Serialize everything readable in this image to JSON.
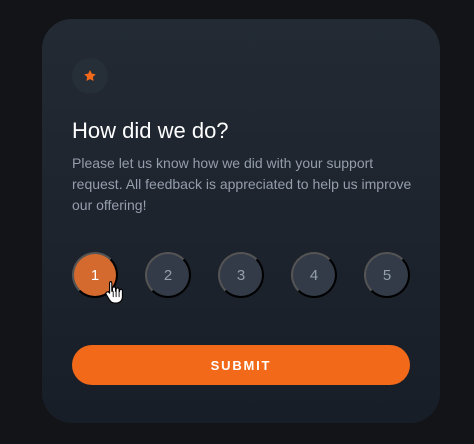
{
  "card": {
    "title": "How did we do?",
    "description": "Please let us know how we did with your support request. All feedback is appreciated to help us improve our offering!",
    "icon": "star-icon"
  },
  "ratings": {
    "options": [
      "1",
      "2",
      "3",
      "4",
      "5"
    ],
    "selected": "1"
  },
  "submit": {
    "label": "SUBMIT"
  },
  "colors": {
    "background": "#121417",
    "card": "#232a34",
    "accent": "#f2691a",
    "selected_rating": "#d56a2e",
    "text": "#ffffff",
    "muted_text": "#959eac",
    "rating_background": "#323b47"
  },
  "pointer": {
    "icon": "hand-cursor-icon"
  }
}
